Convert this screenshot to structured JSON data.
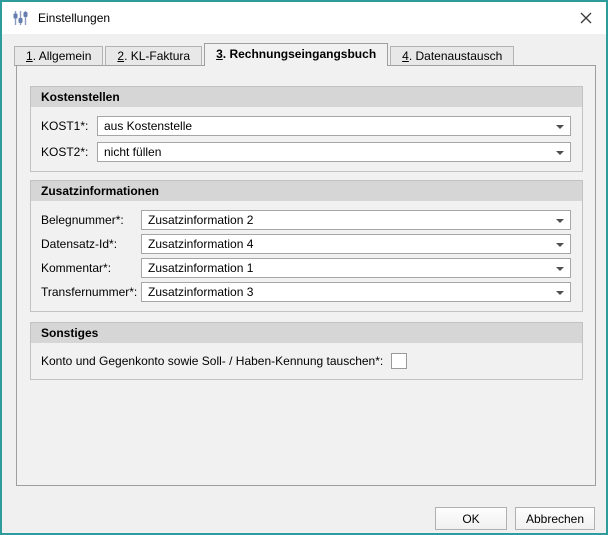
{
  "window": {
    "title": "Einstellungen"
  },
  "tabs": [
    {
      "mnemonic": "1",
      "rest": ". Allgemein"
    },
    {
      "mnemonic": "2",
      "rest": ". KL-Faktura"
    },
    {
      "mnemonic": "3",
      "rest": ". Rechnungseingangsbuch"
    },
    {
      "mnemonic": "4",
      "rest": ". Datenaustausch"
    }
  ],
  "active_tab_index": 2,
  "sections": {
    "kostenstellen": {
      "title": "Kostenstellen",
      "rows": [
        {
          "label": "KOST1*:",
          "value": "aus Kostenstelle"
        },
        {
          "label": "KOST2*:",
          "value": "nicht füllen"
        }
      ]
    },
    "zusatzinformationen": {
      "title": "Zusatzinformationen",
      "rows": [
        {
          "label": "Belegnummer*:",
          "value": "Zusatzinformation 2"
        },
        {
          "label": "Datensatz-Id*:",
          "value": "Zusatzinformation 4"
        },
        {
          "label": "Kommentar*:",
          "value": "Zusatzinformation 1"
        },
        {
          "label": "Transfernummer*:",
          "value": "Zusatzinformation 3"
        }
      ]
    },
    "sonstiges": {
      "title": "Sonstiges",
      "checkbox_label": "Konto und Gegenkonto sowie Soll- / Haben-Kennung tauschen*:",
      "checkbox_checked": false
    }
  },
  "footer": {
    "ok": "OK",
    "cancel": "Abbrechen"
  },
  "icons": {
    "app": "sliders-icon",
    "close": "close-icon",
    "combo": "chevron-down-icon"
  },
  "colors": {
    "accent_border": "#2e9c9c",
    "titlebar_bg": "#ffffff",
    "dialog_bg": "#f0f0f0",
    "section_header_bg": "#d6d6d6"
  }
}
